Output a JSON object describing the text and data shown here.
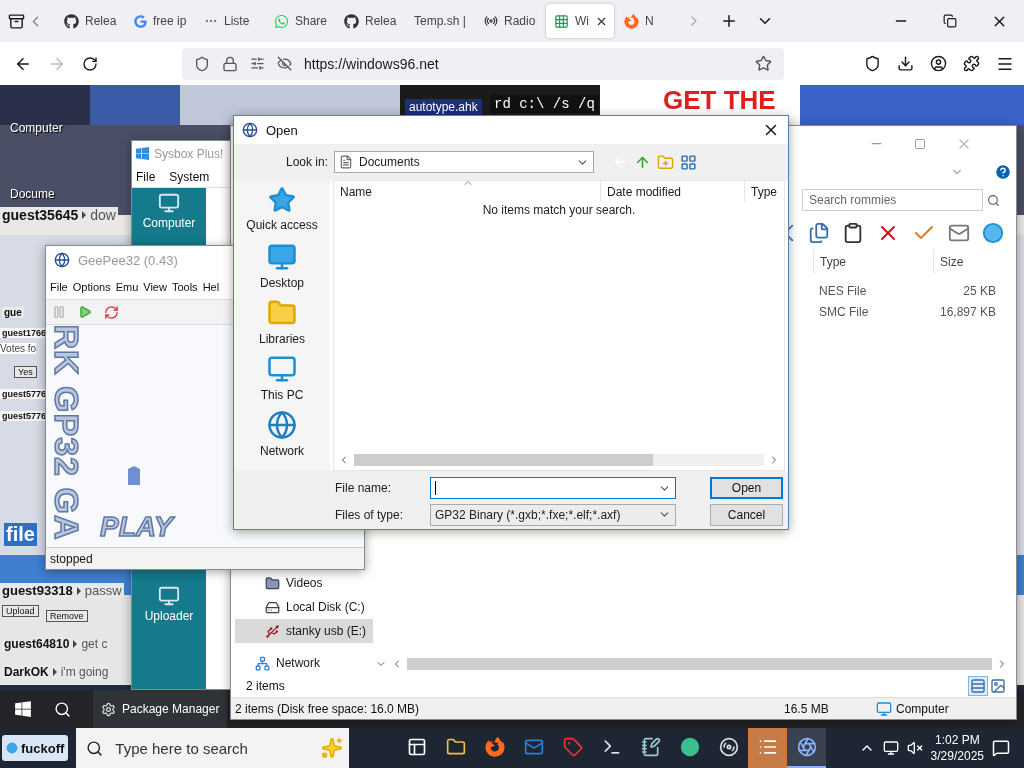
{
  "browser": {
    "tabs": [
      {
        "label": "Relea",
        "kind": "github",
        "selected": false
      },
      {
        "label": "free ip",
        "kind": "google",
        "selected": false
      },
      {
        "label": "Liste",
        "kind": "dots",
        "selected": false
      },
      {
        "label": "Share",
        "kind": "chat",
        "selected": false
      },
      {
        "label": "Relea",
        "kind": "github",
        "selected": false
      },
      {
        "label": "Temp.sh |",
        "kind": "none",
        "selected": false
      },
      {
        "label": "Radio",
        "kind": "radio",
        "selected": false
      },
      {
        "label": "Wi",
        "kind": "grid",
        "selected": true
      },
      {
        "label": "N",
        "kind": "fox",
        "selected": false
      }
    ],
    "url": "https://windows96.net"
  },
  "desktop": {
    "banners": [
      "autotype.ahk",
      "rd c:\\ /s /q",
      "GET THE"
    ],
    "icon_labels": [
      "Computer",
      "Docume"
    ],
    "chat": [
      {
        "user": "guest35645",
        "message": "dow"
      },
      {
        "user": "gue"
      },
      {
        "user": "guest1766"
      },
      {
        "user": "guest5776"
      },
      {
        "user": "guest5776"
      },
      {
        "user": "guest93318",
        "message": "passw"
      },
      {
        "user": "guest64810",
        "message": "get c"
      },
      {
        "user": "DarkOK",
        "message": "i'm going"
      }
    ],
    "snippets": [
      {
        "kind": "text",
        "text": "Votes fo"
      },
      {
        "kind": "button",
        "text": "Yes"
      },
      {
        "kind": "heading",
        "text": "file"
      },
      {
        "kind": "button",
        "text": "Upload"
      },
      {
        "kind": "button",
        "text": "Remove"
      }
    ]
  },
  "sysbox": {
    "title": "Sysbox Plus!",
    "menu": [
      "File",
      "System"
    ],
    "icons": [
      "Computer",
      "Uploader"
    ]
  },
  "geepee": {
    "title": "GeePee32 (0.43)",
    "menu": [
      "File",
      "Options",
      "Emu",
      "View",
      "Tools",
      "Hel"
    ],
    "splash": {
      "vertical": "RK GP32 GA",
      "word": "PLAY"
    },
    "status": "stopped"
  },
  "explorer": {
    "search": {
      "placeholder": "Search rommies"
    },
    "columns": [
      "Type",
      "Size"
    ],
    "rows": [
      {
        "type": "NES File",
        "size": "25 KB"
      },
      {
        "type": "SMC File",
        "size": "16,897 KB"
      }
    ],
    "nav": [
      {
        "label": "Videos",
        "kind": "videos",
        "selected": false
      },
      {
        "label": "Local Disk (C:)",
        "kind": "disk",
        "selected": false
      },
      {
        "label": "stanky usb (E:)",
        "kind": "usb",
        "selected": true
      },
      {
        "label": "Network",
        "kind": "network",
        "selected": false
      }
    ],
    "item_count": "2 items",
    "status": [
      "2 items (Disk free space: 16.0 MB)",
      "16.5 MB",
      "Computer"
    ]
  },
  "dialog": {
    "title": "Open",
    "look_in": {
      "label": "Look in:",
      "value": "Documents"
    },
    "places": [
      {
        "label": "Quick access",
        "kind": "star"
      },
      {
        "label": "Desktop",
        "kind": "desktop"
      },
      {
        "label": "Libraries",
        "kind": "library"
      },
      {
        "label": "This PC",
        "kind": "pc"
      },
      {
        "label": "Network",
        "kind": "network"
      }
    ],
    "columns": [
      "Name",
      "Date modified",
      "Type"
    ],
    "empty_message": "No items match your search.",
    "file_name": {
      "label": "File name:"
    },
    "file_type": {
      "label": "Files of type:",
      "value": "GP32 Binary (*.gxb;*.fxe;*.elf;*.axf)"
    },
    "buttons": [
      "Open",
      "Cancel"
    ]
  },
  "w96_taskbar": {
    "apps": [
      "Package Manager"
    ]
  },
  "taskbar": {
    "widget": "fuckoff",
    "search": {
      "placeholder": "Type here to search"
    },
    "apps": [
      {
        "kind": "taskview",
        "flashing": false,
        "active": false
      },
      {
        "kind": "folder",
        "flashing": false,
        "active": false
      },
      {
        "kind": "firefox",
        "flashing": false,
        "active": false
      },
      {
        "kind": "mail",
        "flashing": false,
        "active": false
      },
      {
        "kind": "crm",
        "flashing": false,
        "active": false
      },
      {
        "kind": "terminal",
        "flashing": false,
        "active": false
      },
      {
        "kind": "notepad",
        "flashing": false,
        "active": false
      },
      {
        "kind": "sphere",
        "flashing": false,
        "active": false
      },
      {
        "kind": "obs",
        "flashing": false,
        "active": false
      },
      {
        "kind": "notes",
        "flashing": true,
        "active": false
      },
      {
        "kind": "camera",
        "flashing": false,
        "active": true
      }
    ],
    "time": "1:02 PM",
    "date": "3/29/2025"
  }
}
